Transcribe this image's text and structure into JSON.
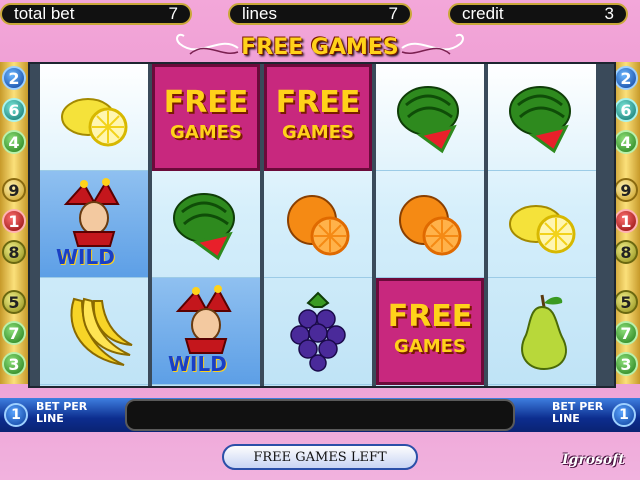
{
  "header": {
    "total_bet_label": "total bet",
    "total_bet_value": "7",
    "lines_label": "lines",
    "lines_value": "7",
    "credit_label": "credit",
    "credit_value": "3"
  },
  "title": "FREE GAMES",
  "reels": [
    [
      "lemon",
      "jester-wild",
      "banana"
    ],
    [
      "free-games",
      "watermelon",
      "jester-wild"
    ],
    [
      "free-games",
      "orange",
      "blackberry"
    ],
    [
      "watermelon",
      "orange",
      "free-games"
    ],
    [
      "watermelon",
      "lemon",
      "pear"
    ]
  ],
  "symbol_text": {
    "free_line1": "FREE",
    "free_line2": "GAMES",
    "wild": "WILD"
  },
  "line_numbers_left": [
    "2",
    "6",
    "4",
    "9",
    "1",
    "8",
    "5",
    "7",
    "3"
  ],
  "line_numbers_right": [
    "2",
    "6",
    "4",
    "9",
    "1",
    "8",
    "5",
    "7",
    "3"
  ],
  "bottom": {
    "left_coin": "1",
    "left_bet_per_line": "BET PER\nLINE",
    "right_coin": "1",
    "right_bet_per_line": "BET PER\nLINE",
    "free_games_left_button": "FREE GAMES LEFT",
    "brand": "Igrosoft"
  }
}
